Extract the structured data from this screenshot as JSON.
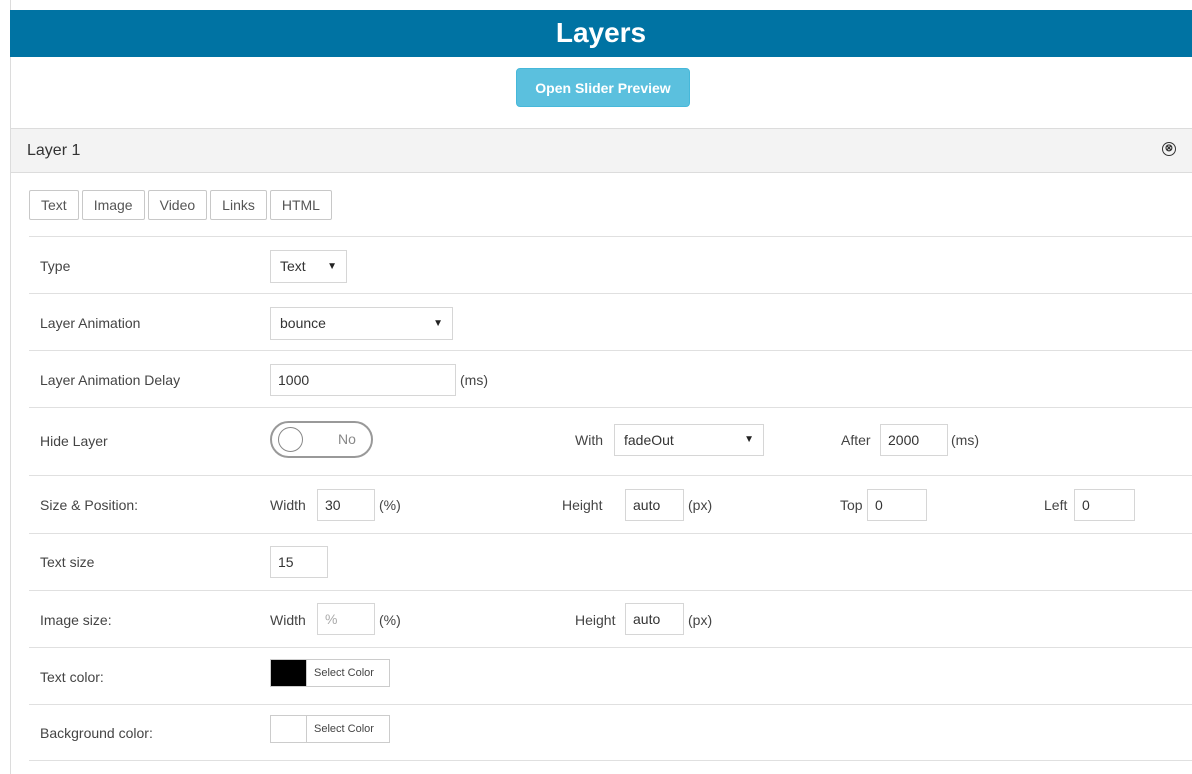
{
  "header": {
    "title": "Layers"
  },
  "preview_button": "Open Slider Preview",
  "layer": {
    "title": "Layer 1",
    "close_icon": "⊗"
  },
  "tabs": [
    "Text",
    "Image",
    "Video",
    "Links",
    "HTML"
  ],
  "fields": {
    "type": {
      "label": "Type",
      "value": "Text"
    },
    "layer_animation": {
      "label": "Layer Animation",
      "value": "bounce"
    },
    "animation_delay": {
      "label": "Layer Animation Delay",
      "value": "1000",
      "unit": "(ms)"
    },
    "hide_layer": {
      "label": "Hide Layer",
      "toggle": "No",
      "with_label": "With",
      "with_value": "fadeOut",
      "after_label": "After",
      "after_value": "2000",
      "after_unit": "(ms)"
    },
    "size_position": {
      "label": "Size & Position:",
      "width_label": "Width",
      "width_value": "30",
      "width_unit": "(%)",
      "height_label": "Height",
      "height_value": "auto",
      "height_unit": "(px)",
      "top_label": "Top",
      "top_value": "0",
      "left_label": "Left",
      "left_value": "0"
    },
    "text_size": {
      "label": "Text size",
      "value": "15"
    },
    "image_size": {
      "label": "Image size:",
      "width_label": "Width",
      "width_placeholder": "%",
      "width_unit": "(%)",
      "height_label": "Height",
      "height_value": "auto",
      "height_unit": "(px)"
    },
    "text_color": {
      "label": "Text color:",
      "button": "Select Color",
      "swatch": "#000000"
    },
    "background_color": {
      "label": "Background color:",
      "button": "Select Color",
      "swatch": "#ffffff"
    }
  },
  "colors": {
    "header_bg": "#0073a3",
    "preview_button_bg": "#5bc0de"
  },
  "icons": {
    "close": "close-circle-icon",
    "dropdown": "caret-down-icon"
  }
}
